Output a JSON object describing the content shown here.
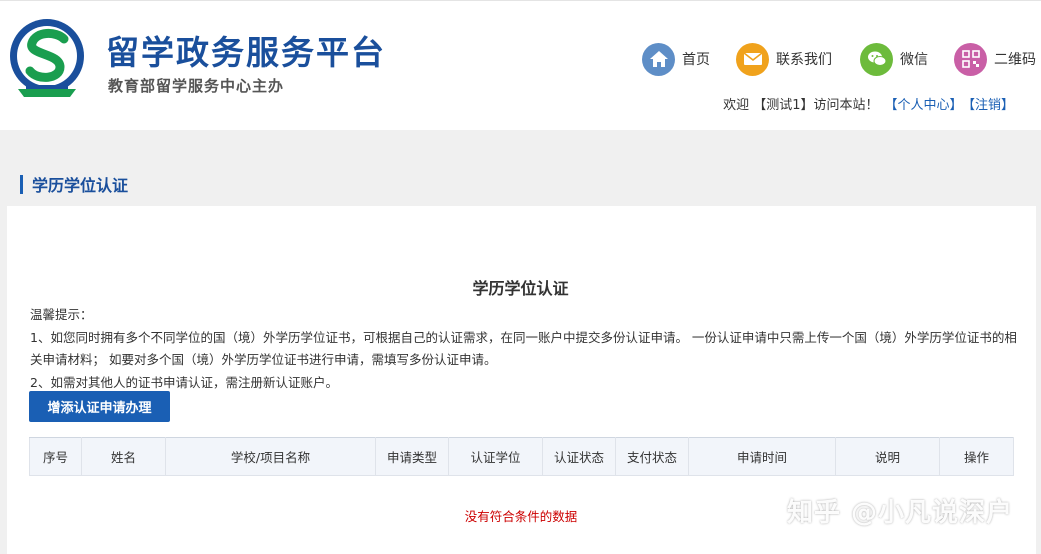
{
  "header": {
    "title": "留学政务服务平台",
    "subtitle": "教育部留学服务中心主办",
    "nav": [
      {
        "label": "首页",
        "icon": "home-icon",
        "color": "#5e8ec7"
      },
      {
        "label": "联系我们",
        "icon": "mail-icon",
        "color": "#f0a21c"
      },
      {
        "label": "微信",
        "icon": "wechat-icon",
        "color": "#6dbb3c"
      },
      {
        "label": "二维码",
        "icon": "qrcode-icon",
        "color": "#c95fa6"
      }
    ],
    "user_bar": {
      "welcome": "欢迎 【测试1】访问本站！",
      "profile_link": "【个人中心】",
      "logout_link": "【注销】"
    }
  },
  "section": {
    "title": "学历学位认证"
  },
  "main": {
    "title": "学历学位认证",
    "notice": {
      "heading": "温馨提示：",
      "line1": "1、如您同时拥有多个不同学位的国（境）外学历学位证书，可根据自己的认证需求，在同一账户中提交多份认证申请。 一份认证申请中只需上传一个国（境）外学历学位证书的相关申请材料； 如要对多个国（境）外学历学位证书进行申请，需填写多份认证申请。",
      "line2": "2、如需对其他人的证书申请认证，需注册新认证账户。"
    },
    "add_button": "增添认证申请办理",
    "table": {
      "columns": [
        "序号",
        "姓名",
        "学校/项目名称",
        "申请类型",
        "认证学位",
        "认证状态",
        "支付状态",
        "申请时间",
        "说明",
        "操作"
      ],
      "empty_text": "没有符合条件的数据"
    }
  },
  "watermark": "知乎 @小凡说深户",
  "colors": {
    "brand_blue": "#1a5fb4",
    "title_blue": "#1a4f9c",
    "empty_red": "#cc0000",
    "band_grey": "#f0f0f0"
  }
}
